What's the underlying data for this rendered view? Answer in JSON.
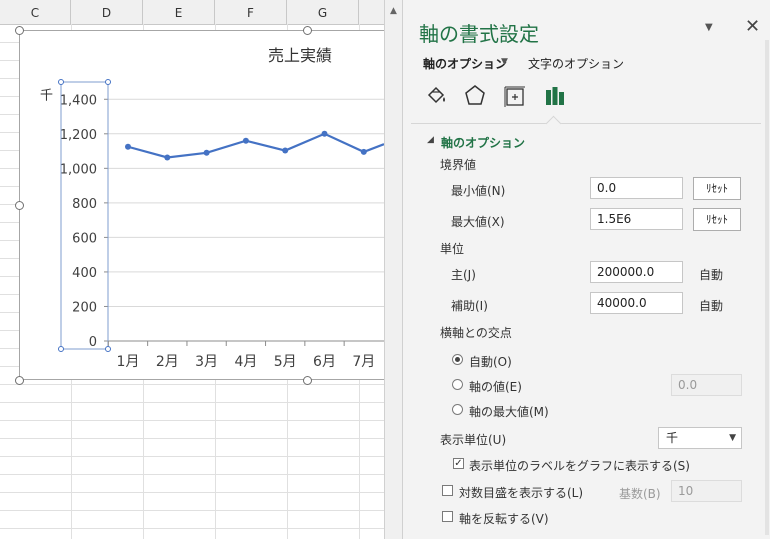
{
  "sheet": {
    "columns": [
      "C",
      "D",
      "E",
      "F",
      "G"
    ]
  },
  "chart": {
    "title": "売上実績",
    "unit_label": "千"
  },
  "chart_data": {
    "type": "line",
    "title": "売上実績",
    "categories": [
      "1月",
      "2月",
      "3月",
      "4月",
      "5月",
      "6月",
      "7月"
    ],
    "series": [
      {
        "values": [
          1125,
          1063,
          1090,
          1160,
          1103,
          1200,
          1095
        ]
      }
    ],
    "y_ticks": [
      "0",
      "200",
      "400",
      "600",
      "800",
      "1,000",
      "1,200",
      "1,400"
    ],
    "ylim": [
      0,
      1500
    ],
    "grid": true,
    "color": "#4472c4"
  },
  "pane": {
    "title": "軸の書式設定",
    "tab_axis": "軸のオプション",
    "tab_text": "文字のオプション",
    "icons": [
      "fill-line-icon",
      "effects-icon",
      "size-properties-icon",
      "axis-options-icon"
    ],
    "section_axis_options": "軸のオプション",
    "bounds_label": "境界値",
    "min_label": "最小値(N)",
    "min_value": "0.0",
    "max_label": "最大値(X)",
    "max_value": "1.5E6",
    "reset_label": "ﾘｾｯﾄ",
    "units_label": "単位",
    "major_label": "主(J)",
    "major_value": "200000.0",
    "minor_label": "補助(I)",
    "minor_value": "40000.0",
    "auto_label": "自動",
    "cross_label": "横軸との交点",
    "cross_auto": "自動(O)",
    "cross_value_label": "軸の値(E)",
    "cross_value": "0.0",
    "cross_max": "軸の最大値(M)",
    "display_units_label": "表示単位(U)",
    "display_units_value": "千",
    "show_units_label": "表示単位のラベルをグラフに表示する(S)",
    "log_scale_label": "対数目盛を表示する(L)",
    "base_label": "基数(B)",
    "base_value": "10",
    "reverse_label": "軸を反転する(V)"
  },
  "colors": {
    "accent": "#217346",
    "series": "#4472c4"
  }
}
